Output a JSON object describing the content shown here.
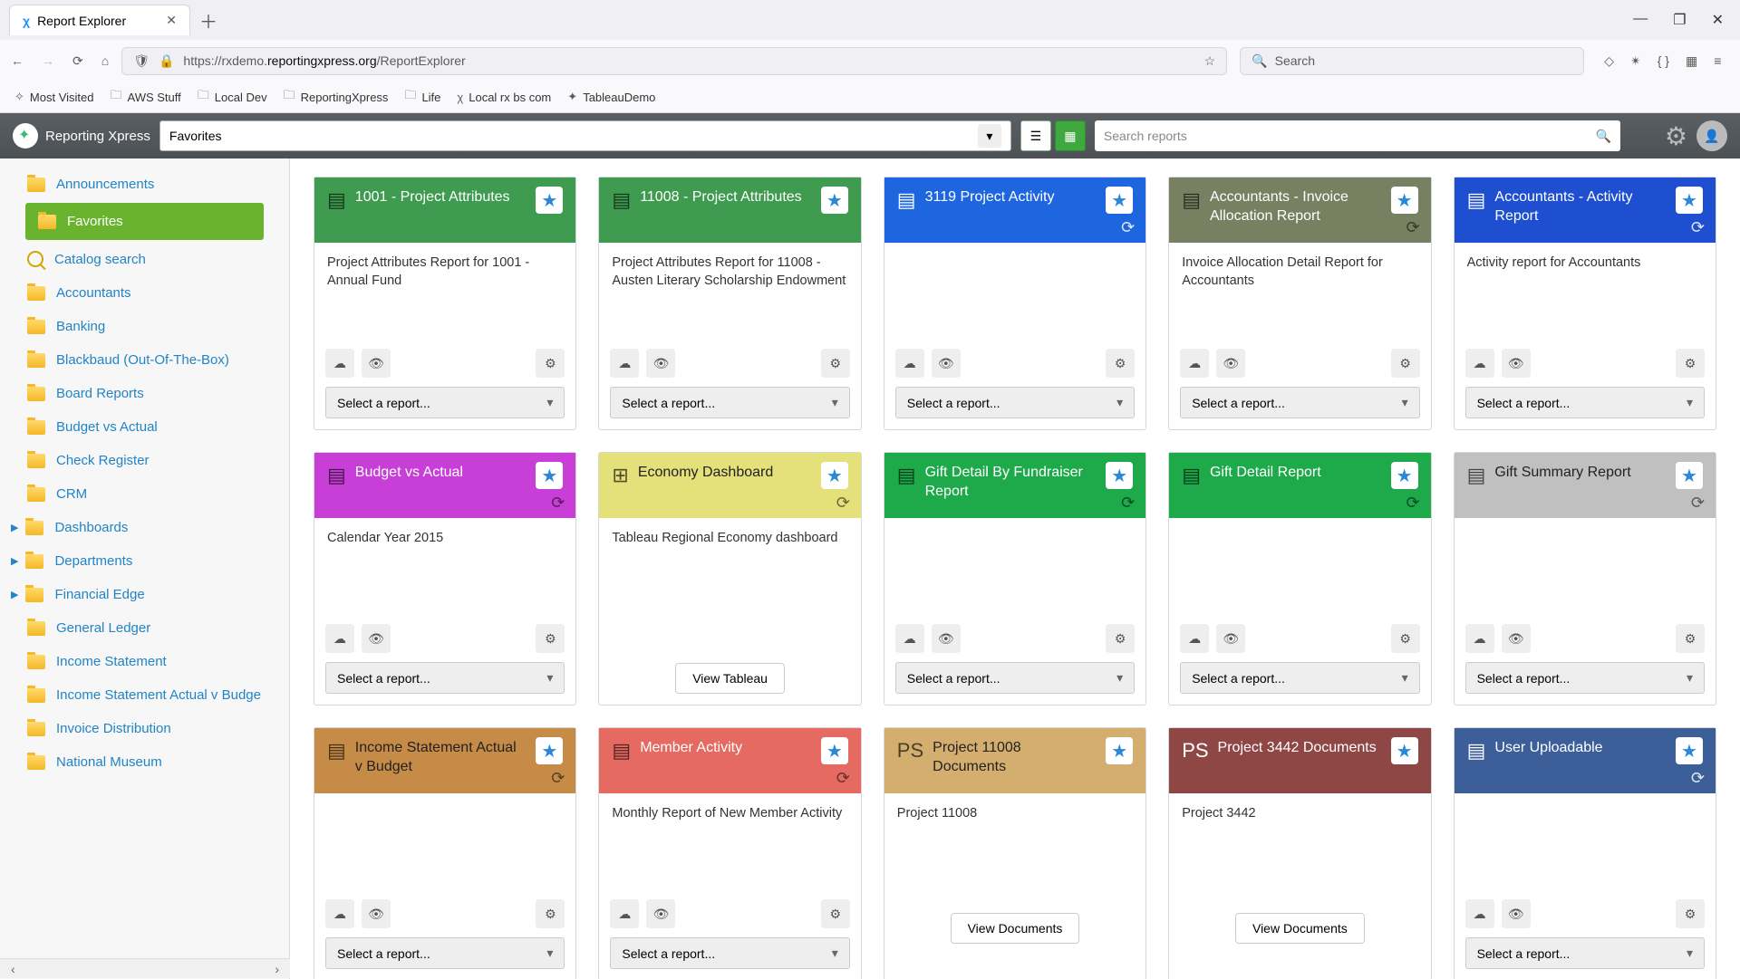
{
  "browser": {
    "tab_title": "Report Explorer",
    "url_prefix": "https://rxdemo.",
    "url_domain": "reportingxpress.org",
    "url_path": "/ReportExplorer",
    "search_placeholder": "Search",
    "bookmarks": [
      "Most Visited",
      "AWS Stuff",
      "Local Dev",
      "ReportingXpress",
      "Life",
      "Local rx bs com",
      "TableauDemo"
    ]
  },
  "app": {
    "brand": "Reporting Xpress",
    "context": "Favorites",
    "search_placeholder": "Search reports"
  },
  "sidebar": {
    "items": [
      {
        "label": "Announcements",
        "type": "folder"
      },
      {
        "label": "Favorites",
        "type": "folder",
        "active": true
      },
      {
        "label": "Catalog search",
        "type": "search"
      },
      {
        "label": "Accountants",
        "type": "folder"
      },
      {
        "label": "Banking",
        "type": "folder"
      },
      {
        "label": "Blackbaud (Out-Of-The-Box)",
        "type": "folder"
      },
      {
        "label": "Board Reports",
        "type": "folder"
      },
      {
        "label": "Budget vs Actual",
        "type": "folder"
      },
      {
        "label": "Check Register",
        "type": "folder"
      },
      {
        "label": "CRM",
        "type": "folder"
      },
      {
        "label": "Dashboards",
        "type": "folder",
        "chev": true
      },
      {
        "label": "Departments",
        "type": "folder",
        "chev": true
      },
      {
        "label": "Financial Edge",
        "type": "folder",
        "chev": true
      },
      {
        "label": "General Ledger",
        "type": "folder"
      },
      {
        "label": "Income Statement",
        "type": "folder"
      },
      {
        "label": "Income Statement Actual v Budge",
        "type": "folder"
      },
      {
        "label": "Invoice Distribution",
        "type": "folder"
      },
      {
        "label": "National Museum",
        "type": "folder"
      }
    ]
  },
  "cards": [
    {
      "title": "1001 - Project Attributes",
      "desc": "Project Attributes Report for 1001 - Annual Fund",
      "color": "h-green1",
      "dark": true,
      "sel": "Select a report..."
    },
    {
      "title": "11008 - Project Attributes",
      "desc": "Project Attributes Report for 11008 - Austen Literary Scholarship Endowment",
      "color": "h-green1",
      "dark": true,
      "sel": "Select a report..."
    },
    {
      "title": "3119 Project Activity",
      "desc": "",
      "color": "h-blue",
      "white_ic": true,
      "refresh": "white",
      "sel": "Select a report..."
    },
    {
      "title": "Accountants - Invoice Allocation Report",
      "desc": "Invoice Allocation Detail Report for Accountants",
      "color": "h-olive",
      "dark": true,
      "refresh": "dark",
      "sel": "Select a report..."
    },
    {
      "title": "Accountants - Activity Report",
      "desc": "Activity report for Accountants",
      "color": "h-blue2",
      "white_ic": true,
      "refresh": "white",
      "sel": "Select a report..."
    },
    {
      "title": "Budget vs Actual",
      "desc": "Calendar Year 2015",
      "color": "h-magenta",
      "dark": true,
      "refresh": "dark",
      "sel": "Select a report..."
    },
    {
      "title": "Economy Dashboard",
      "desc": "Tableau Regional Economy dashboard",
      "color": "h-yellow",
      "title_dark": true,
      "tableau": true,
      "btn": "View Tableau",
      "refresh": "dark"
    },
    {
      "title": "Gift Detail By Fundraiser Report",
      "desc": "",
      "color": "h-green2",
      "dark": true,
      "refresh": "dark",
      "sel": "Select a report..."
    },
    {
      "title": "Gift Detail Report",
      "desc": "",
      "color": "h-green2",
      "dark": true,
      "refresh": "dark",
      "sel": "Select a report..."
    },
    {
      "title": "Gift Summary Report",
      "desc": "",
      "color": "h-grey",
      "title_dark": true,
      "dark": true,
      "refresh": "dark",
      "sel": "Select a report..."
    },
    {
      "title": "Income Statement Actual v Budget",
      "desc": "",
      "color": "h-brown",
      "title_dark": true,
      "dark": true,
      "refresh": "dark",
      "sel": "Select a report..."
    },
    {
      "title": "Member Activity",
      "desc": "Monthly Report of New Member Activity",
      "color": "h-coral",
      "dark": true,
      "refresh": "dark",
      "sel": "Select a report..."
    },
    {
      "title": "Project 11008 Documents",
      "desc": "Project 11008",
      "color": "h-tan",
      "title_dark": true,
      "ps": true,
      "docs": true,
      "btn": "View Documents"
    },
    {
      "title": "Project 3442 Documents",
      "desc": "Project 3442",
      "color": "h-maroon",
      "ps": true,
      "white_ic": true,
      "docs": true,
      "btn": "View Documents"
    },
    {
      "title": "User Uploadable",
      "desc": "",
      "color": "h-navy",
      "white_ic": true,
      "refresh": "white",
      "sel": "Select a report..."
    }
  ]
}
